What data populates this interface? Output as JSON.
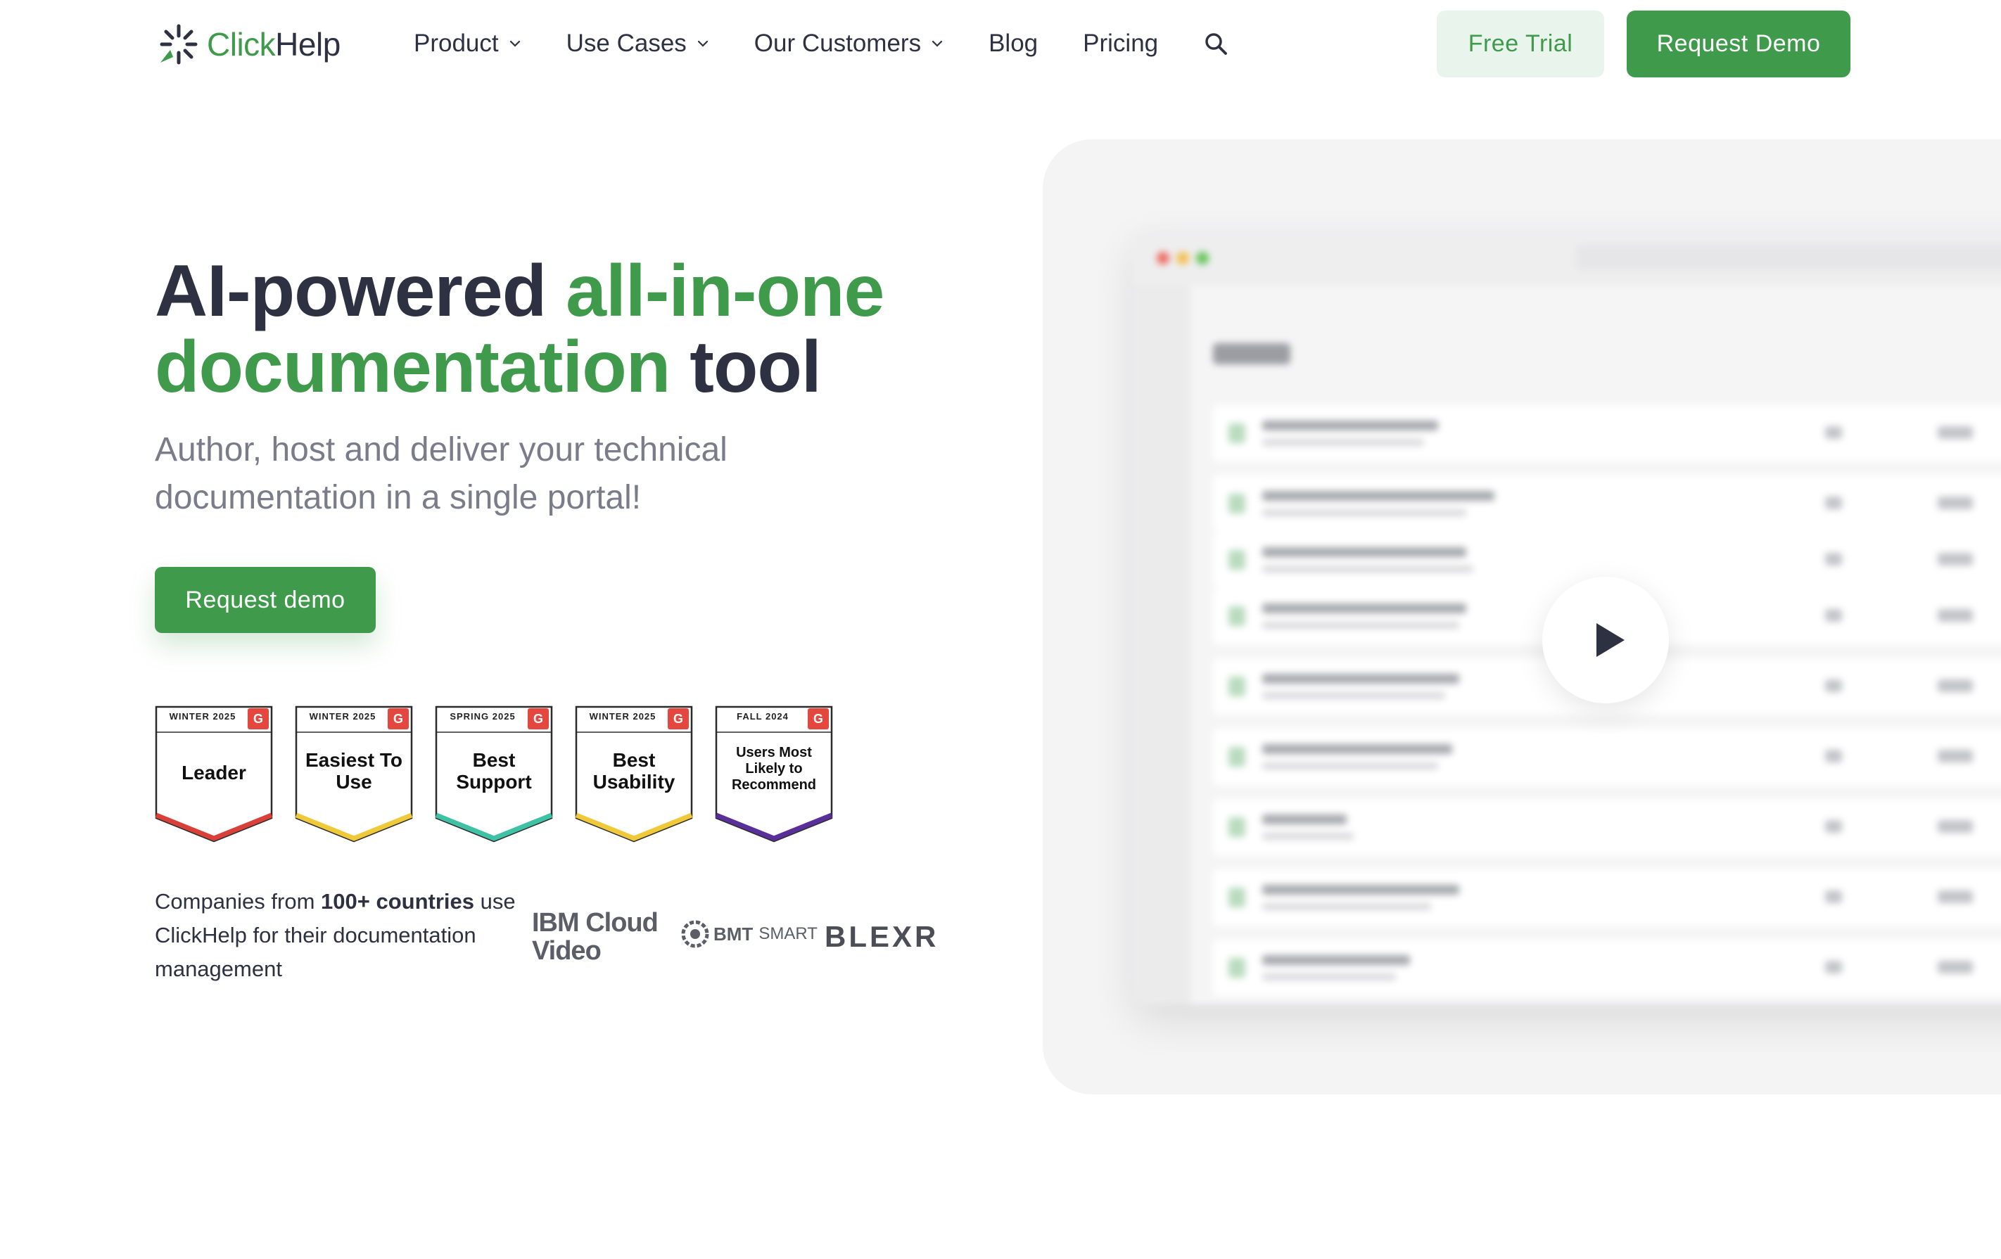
{
  "header": {
    "logo_part1": "Click",
    "logo_part2": "Help",
    "nav": [
      {
        "label": "Product",
        "has_dropdown": true
      },
      {
        "label": "Use Cases",
        "has_dropdown": true
      },
      {
        "label": "Our Customers",
        "has_dropdown": true
      },
      {
        "label": "Blog",
        "has_dropdown": false
      },
      {
        "label": "Pricing",
        "has_dropdown": false
      }
    ],
    "search_icon": "search-icon",
    "free_trial_label": "Free Trial",
    "request_demo_label": "Request Demo"
  },
  "hero": {
    "title_part1": "AI-powered ",
    "title_part2": "all-in-one",
    "title_part3": "documentation",
    "title_part4": " tool",
    "subtitle": "Author, host and deliver your technical documentation in a single portal!",
    "cta_label": "Request demo"
  },
  "badges": [
    {
      "season": "WINTER 2025",
      "title": "Leader",
      "accent": "#d9403a"
    },
    {
      "season": "WINTER 2025",
      "title": "Easiest To Use",
      "accent": "#f0c93a"
    },
    {
      "season": "SPRING 2025",
      "title": "Best Support",
      "accent": "#3fc1a5"
    },
    {
      "season": "WINTER 2025",
      "title": "Best Usability",
      "accent": "#f0c93a"
    },
    {
      "season": "FALL 2024",
      "title": "Users Most Likely to Recommend",
      "accent": "#5b2f9a"
    }
  ],
  "badge_brand": "G",
  "companies": {
    "text_part1": "Companies from ",
    "text_bold": "100+ countries",
    "text_part2": " use ClickHelp for their documentation management"
  },
  "customer_logos": {
    "ibm_line1": "IBM Cloud",
    "ibm_line2": "Video",
    "bmt_bold": "BMT",
    "bmt_light": "SMART",
    "blexr": "BLEXR"
  },
  "colors": {
    "brand_green": "#3f9a4b",
    "light_green": "#e9f5ec",
    "text_dark": "#2d3142",
    "text_gray": "#7a7d89",
    "panel_bg": "#f4f4f5"
  },
  "video": {
    "play_icon": "play-icon"
  }
}
